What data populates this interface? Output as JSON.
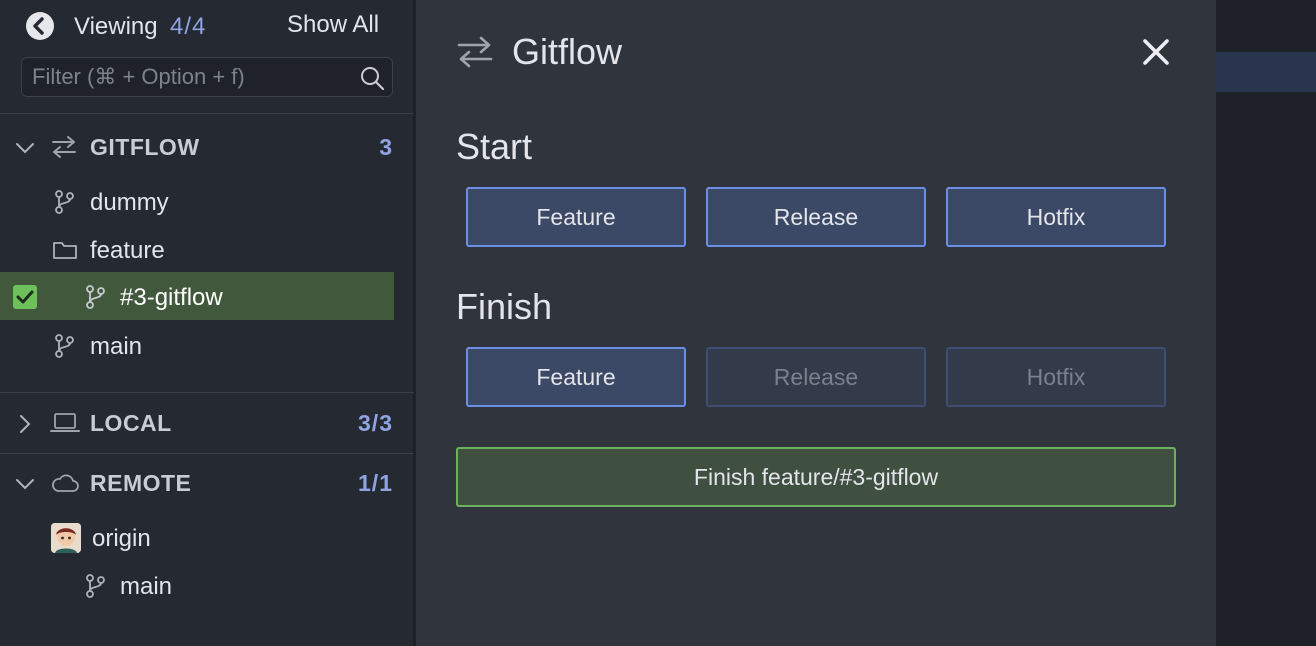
{
  "sidebar": {
    "viewing_label": "Viewing",
    "viewing_count": "4/4",
    "show_all_label": "Show All",
    "filter_placeholder": "Filter (⌘ + Option + f)",
    "sections": {
      "gitflow": {
        "title": "GITFLOW",
        "count": "3",
        "items": {
          "dummy": "dummy",
          "feature_folder": "feature",
          "feature_branch": "#3-gitflow",
          "main": "main"
        }
      },
      "local": {
        "title": "LOCAL",
        "count": "3/3"
      },
      "remote": {
        "title": "REMOTE",
        "count": "1/1",
        "origin": "origin",
        "origin_main": "main"
      }
    }
  },
  "dialog": {
    "title": "Gitflow",
    "start_heading": "Start",
    "start_buttons": {
      "feature": "Feature",
      "release": "Release",
      "hotfix": "Hotfix"
    },
    "finish_heading": "Finish",
    "finish_buttons": {
      "feature": "Feature",
      "release": "Release",
      "hotfix": "Hotfix"
    },
    "finish_action": "Finish feature/#3-gitflow"
  },
  "colors": {
    "accent_blue": "#6c8fe6",
    "count_blue": "#8fa4e3",
    "success_green": "#6ab35a",
    "selected_row": "#41583c"
  },
  "icons": [
    "back-arrow-icon",
    "search-icon",
    "chevron-down-icon",
    "chevron-right-icon",
    "gitflow-arrows-icon",
    "branch-icon",
    "folder-icon",
    "laptop-icon",
    "cloud-icon",
    "checkbox-checked-icon",
    "close-icon"
  ]
}
